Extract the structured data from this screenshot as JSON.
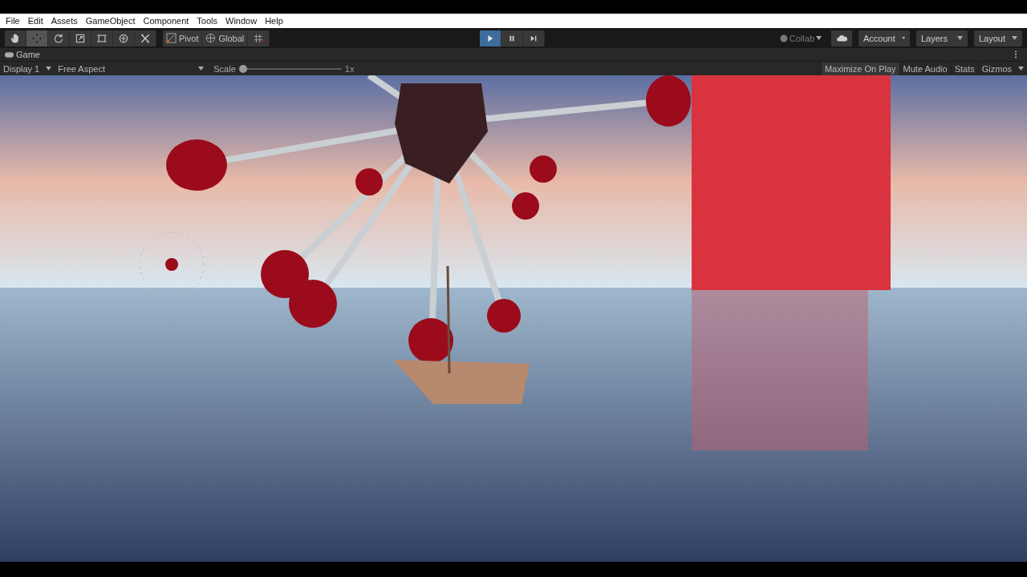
{
  "menu": [
    "File",
    "Edit",
    "Assets",
    "GameObject",
    "Component",
    "Tools",
    "Window",
    "Help"
  ],
  "toolbar": {
    "tools": [
      {
        "kind": "hand",
        "selected": false
      },
      {
        "kind": "move",
        "selected": true
      },
      {
        "kind": "rotate",
        "selected": false
      },
      {
        "kind": "scale",
        "selected": false
      },
      {
        "kind": "rect",
        "selected": false
      },
      {
        "kind": "transform",
        "selected": false
      },
      {
        "kind": "custom",
        "selected": false
      }
    ],
    "pivot": "Pivot",
    "global": "Global",
    "play_controls": [
      {
        "kind": "play",
        "selected": true
      },
      {
        "kind": "pause",
        "selected": false
      },
      {
        "kind": "step",
        "selected": false
      }
    ],
    "collab": {
      "label": "Collab",
      "disabled": true
    },
    "account": "Account",
    "layers": "Layers",
    "layout": "Layout"
  },
  "game_tab": {
    "title": "Game"
  },
  "game_toolbar": {
    "display": "Display 1",
    "aspect": "Free Aspect",
    "scale_label": "Scale",
    "scale": {
      "level": 0
    },
    "scale_value": "1x",
    "toggles": [
      "Maximize On Play",
      "Mute Audio",
      "Stats"
    ],
    "gizmos": "Gizmos"
  }
}
